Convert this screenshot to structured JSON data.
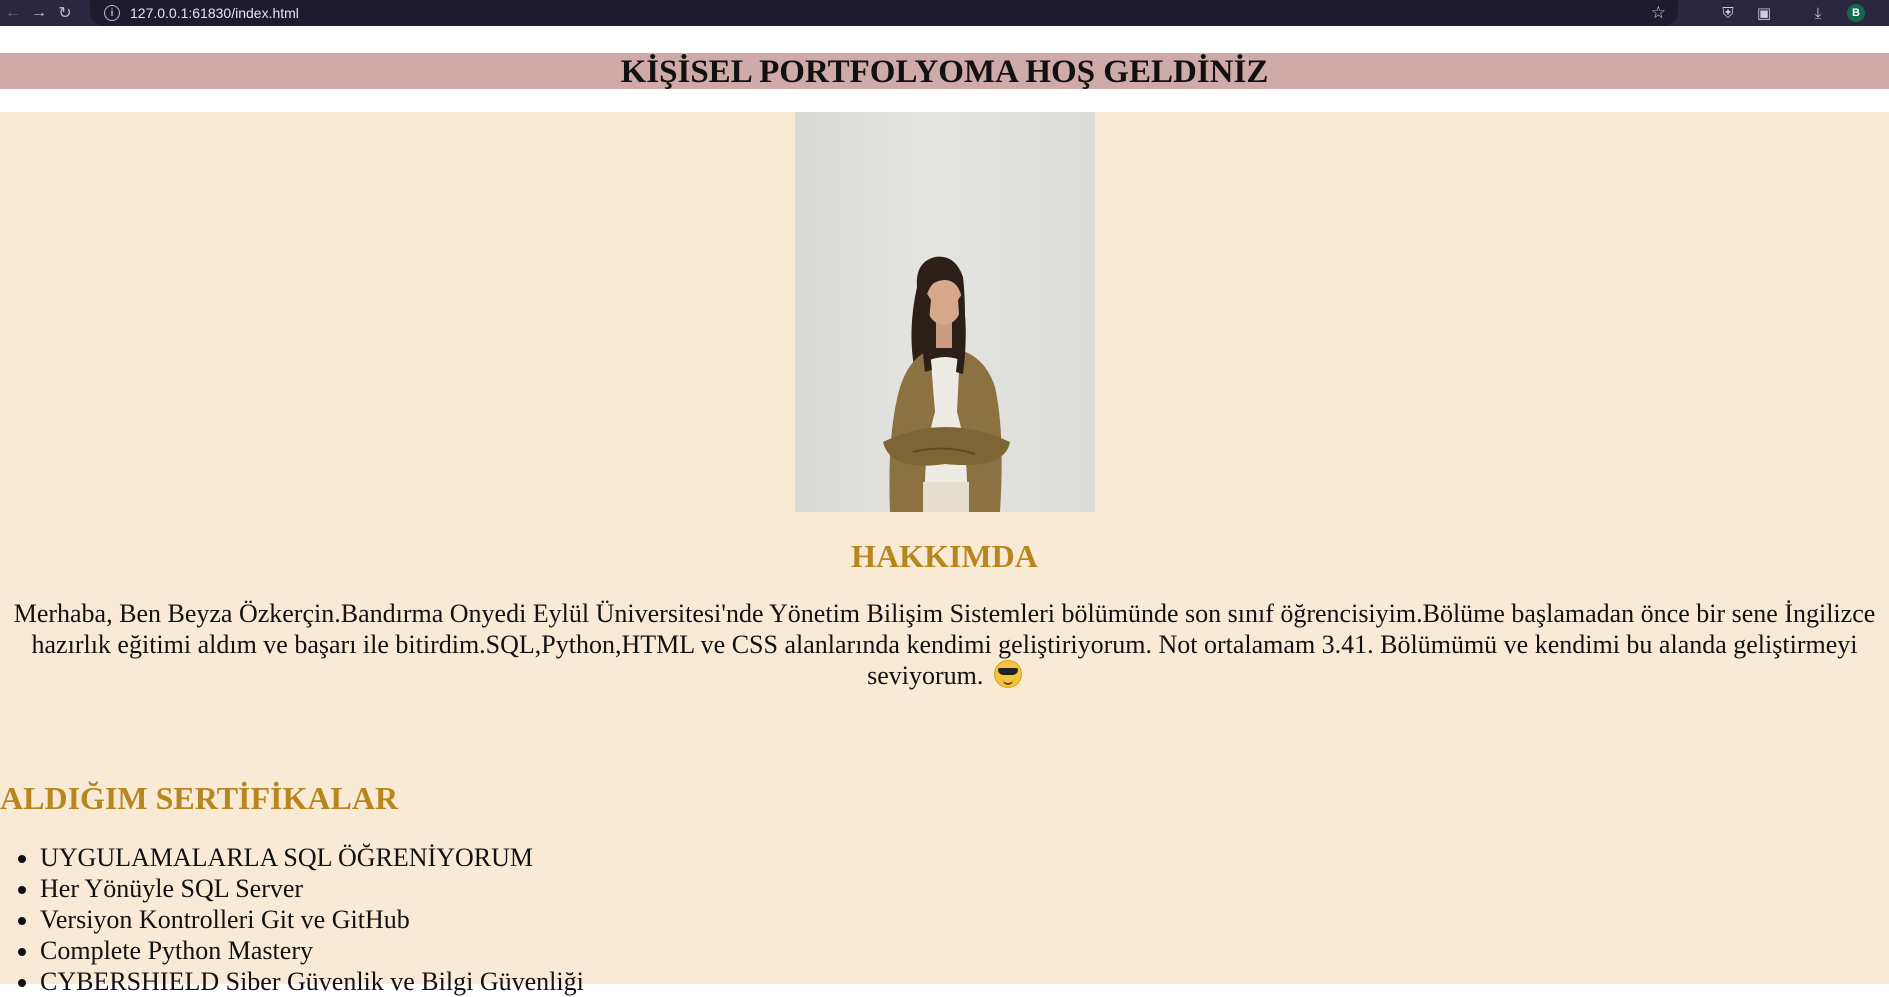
{
  "browser": {
    "url": "127.0.0.1:61830/index.html",
    "profile_initial": "B"
  },
  "header": {
    "title": "KİŞİSEL PORTFOLYOMA HOŞ GELDİNİZ"
  },
  "about": {
    "title": "HAKKIMDA",
    "text": "Merhaba, Ben Beyza Özkerçin.Bandırma Onyedi Eylül Üniversitesi'nde Yönetim Bilişim Sistemleri bölümünde son sınıf öğrencisiyim.Bölüme başlamadan önce bir sene İngilizce hazırlık eğitimi aldım ve başarı ile bitirdim.SQL,Python,HTML ve CSS alanlarında kendimi geliştiriyorum. Not ortalamam 3.41. Bölümümü ve kendimi bu alanda geliştirmeyi seviyorum."
  },
  "certificates": {
    "title": "ALDIĞIM SERTİFİKALAR",
    "items": [
      "UYGULAMALARLA SQL ÖĞRENİYORUM",
      "Her Yönüyle SQL Server",
      "Versiyon Kontrolleri Git ve GitHub",
      "Complete Python Mastery",
      "CYBERSHIELD Siber Güvenlik ve Bilgi Güvenliği"
    ]
  },
  "colors": {
    "header_bg": "#d0aaa9",
    "page_bg": "#f9ead6",
    "heading_gold": "#b8861f"
  }
}
